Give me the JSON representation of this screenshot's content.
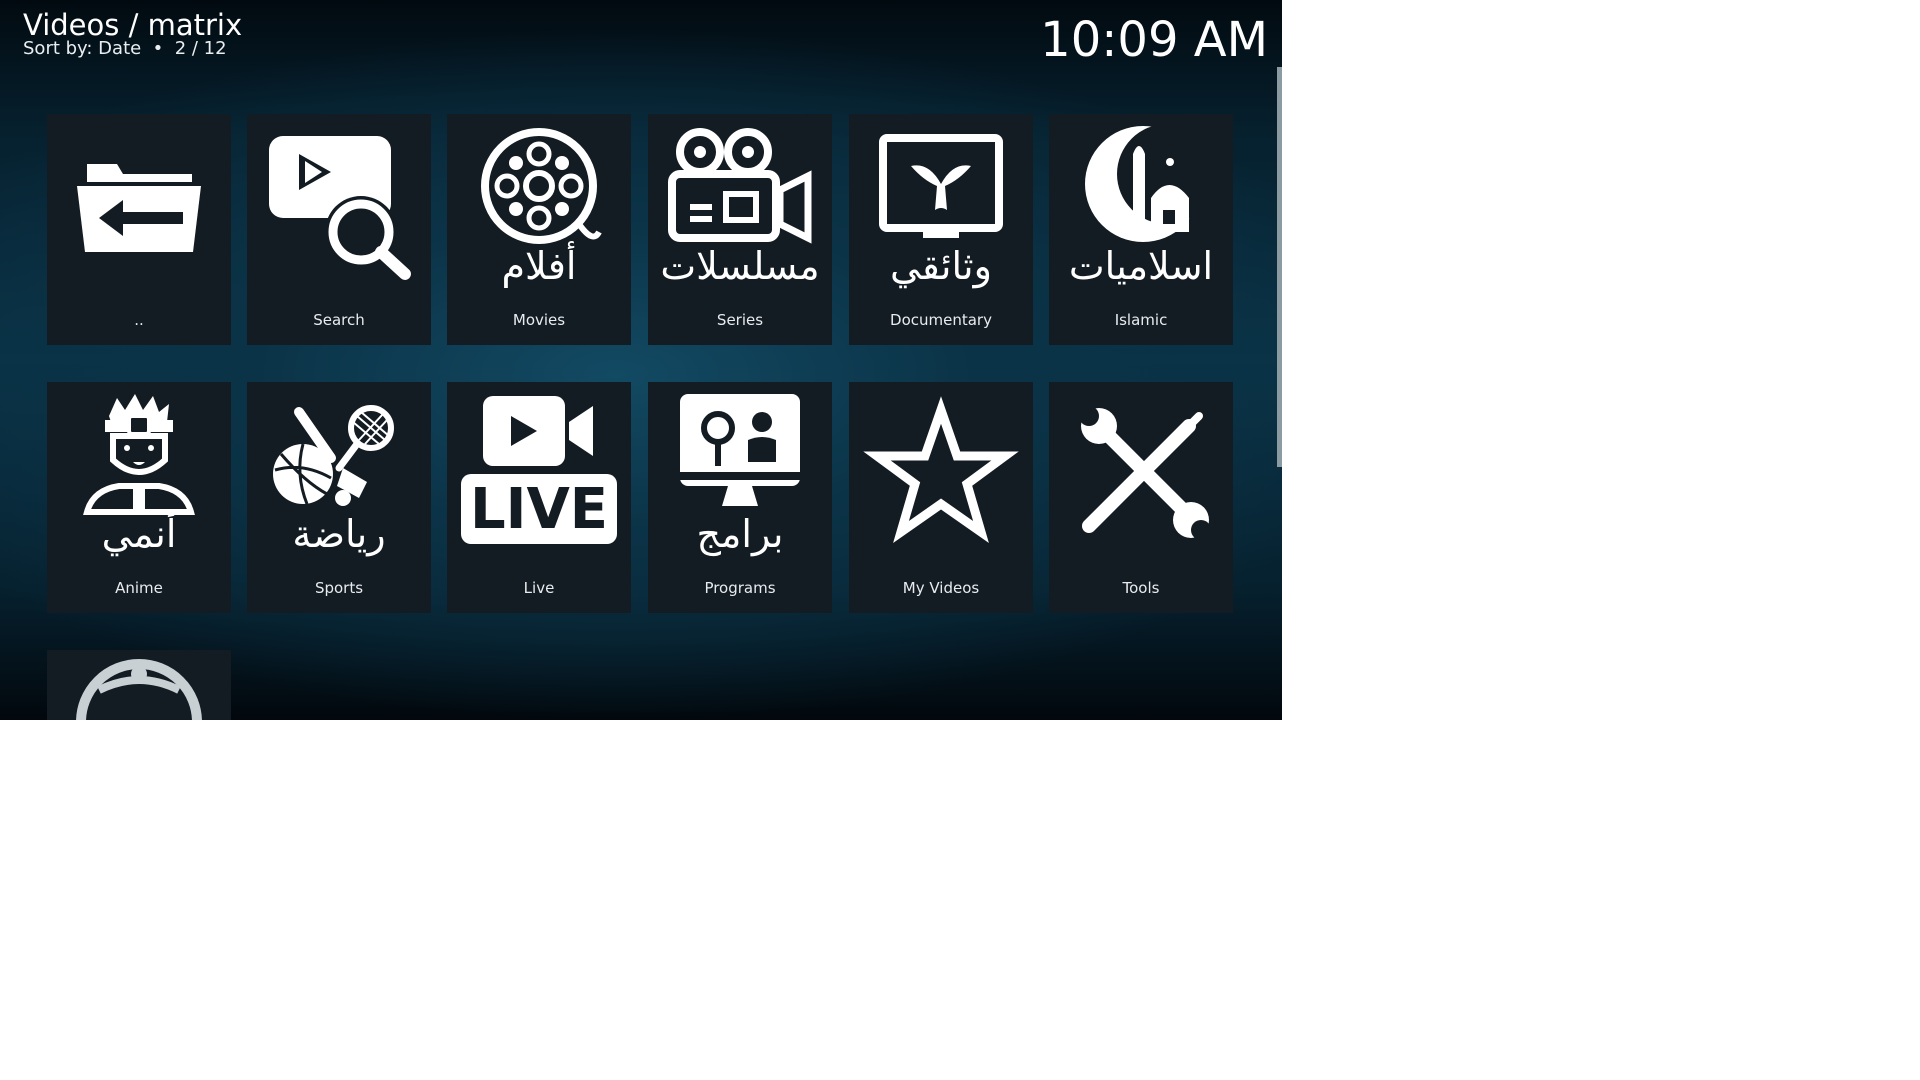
{
  "header": {
    "path": "Videos / matrix",
    "sort": "Sort by: Date  •  2 / 12",
    "clock": "10:09 AM"
  },
  "tiles": [
    {
      "label": "..",
      "arabic": "",
      "icon": "folder-back-icon"
    },
    {
      "label": "Search",
      "arabic": "",
      "icon": "video-search-icon"
    },
    {
      "label": "Movies",
      "arabic": "أفلام",
      "icon": "film-reel-icon"
    },
    {
      "label": "Series",
      "arabic": "مسلسلات",
      "icon": "video-camera-icon"
    },
    {
      "label": "Documentary",
      "arabic": "وثائقي",
      "icon": "whale-tv-icon"
    },
    {
      "label": "Islamic",
      "arabic": "اسلاميات",
      "icon": "crescent-mosque-icon"
    },
    {
      "label": "Anime",
      "arabic": "أنمي",
      "icon": "anime-character-icon"
    },
    {
      "label": "Sports",
      "arabic": "رياضة",
      "icon": "sports-balls-icon"
    },
    {
      "label": "Live",
      "arabic": "",
      "icon": "live-camera-icon"
    },
    {
      "label": "Programs",
      "arabic": "برامج",
      "icon": "monitor-presenter-icon"
    },
    {
      "label": "My Videos",
      "arabic": "",
      "icon": "star-icon"
    },
    {
      "label": "Tools",
      "arabic": "",
      "icon": "wrench-screwdriver-icon"
    },
    {
      "label": "",
      "arabic": "",
      "icon": "globe-icon"
    }
  ],
  "live_text": "LIVE"
}
